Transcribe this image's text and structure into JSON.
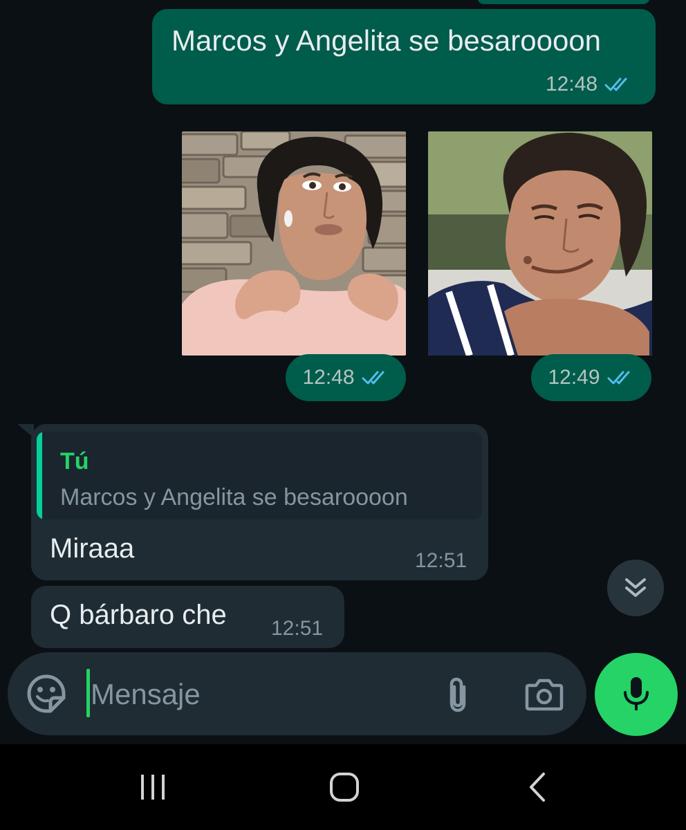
{
  "colors": {
    "background": "#0b1014",
    "outgoing_bubble": "#005c4b",
    "incoming_bubble": "#1f2c34",
    "read_ticks": "#53bdeb",
    "accent_green": "#25d366"
  },
  "messages": {
    "outgoing_text": {
      "text": "Marcos y Angelita se besaroooon",
      "time": "12:48",
      "status": "read"
    },
    "sticker_1": {
      "time": "12:48",
      "status": "read"
    },
    "sticker_2": {
      "time": "12:49",
      "status": "read"
    },
    "incoming_reply": {
      "quote_author": "Tú",
      "quote_text": "Marcos y Angelita se besaroooon",
      "text": "Miraaa",
      "time": "12:51"
    },
    "incoming_2": {
      "text": "Q bárbaro che",
      "time": "12:51"
    }
  },
  "composer": {
    "placeholder": "Mensaje",
    "icons": [
      "emoji-sticker-icon",
      "paperclip-icon",
      "camera-icon",
      "microphone-icon"
    ]
  },
  "scroll_button": {
    "icon": "double-chevron-down-icon"
  },
  "navbar": {
    "icons": [
      "recents-icon",
      "home-icon",
      "back-icon"
    ]
  }
}
